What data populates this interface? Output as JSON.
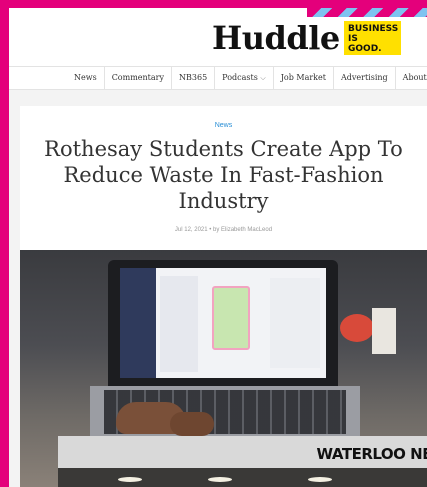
{
  "header": {
    "logo_text": "Huddle",
    "badge_lines": [
      "BUSINESS",
      "IS",
      "GOOD."
    ],
    "brand_color": "#e4007b",
    "badge_color": "#ffe000"
  },
  "nav": {
    "items": [
      "News",
      "Commentary",
      "NB365",
      "Podcasts",
      "Job Market",
      "Advertising",
      "About"
    ],
    "dropdown_icon": "chevron-down-icon"
  },
  "article": {
    "category": "News",
    "title": "Rothesay Students Create App To Reduce Waste In Fast-Fashion Industry",
    "meta": "Jul 12, 2021 • by Elizabeth MacLeod",
    "category_color": "#2a8fd6"
  },
  "promo": {
    "text": "WATERLOO NEW"
  }
}
